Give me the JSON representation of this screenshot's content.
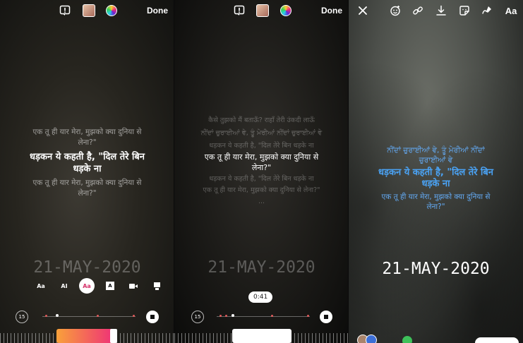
{
  "panel1": {
    "toolbar": {
      "done_label": "Done"
    },
    "lyrics": {
      "line_before": "एक तू ही यार मेरा, मुझको क्या दुनिया से लेना?\"",
      "current": "धड़कन ये कहती है, \"दिल तेरे बिन धड़के ना",
      "line_after": "एक तू ही यार मेरा, मुझको क्या दुनिया से लेना?\""
    },
    "date_sticker": "21-MAY-2020",
    "style_options": [
      "Aa",
      "AI",
      "Aa",
      "A",
      "video",
      "card"
    ],
    "skip_label": "15"
  },
  "panel2": {
    "toolbar": {
      "done_label": "Done"
    },
    "lyrics": {
      "l1": "कैसे तुझको मैं बताऊँ? राहाँ तेरी उंकदी लाऊँ",
      "l2": "ਨੀਂਦਾਂ ਚੁਰਾਈਆਂ ਵੇ, ਤੂੰ ਮੇਰੀਆਂ ਨੀਂਦਾਂ ਚੁਰਾਈਆਂ ਵੇ",
      "l3": "धड़कन ये कहती है, \"दिल तेरे बिन धड़के ना",
      "current": "एक तू ही यार मेरा, मुझको क्या दुनिया से लेना?\"",
      "l5": "धड़कन ये कहती है, \"दिल तेरे बिन धड़के ना",
      "l6": "एक तू ही यार मेरा, मुझको क्या दुनिया से लेना?\"",
      "ellipsis": "..."
    },
    "date_sticker": "21-MAY-2020",
    "time_bubble": "0:41",
    "skip_label": "15"
  },
  "panel3": {
    "toolbar": {
      "text_tool_label": "Aa"
    },
    "lyrics": {
      "before": "ਨੀਂਦਾਂ ਚੁਰਾਈਆਂ ਵੇ, ਤੂੰ ਮੇਰੀਆਂ ਨੀਂਦਾਂ ਚੁਰਾਈਆਂ ਵੇ",
      "current": "धड़कन ये कहती है, \"दिल तेरे बिन धड़के ना",
      "after": "एक तू ही यार मेरा, मुझको क्या दुनिया से लेना?\""
    },
    "date_sticker": "21-MAY-2020",
    "lyric_color": "#4aa3f5"
  },
  "colors": {
    "accent_pink": "#ee2a7b",
    "accent_orange": "#f9a13a",
    "done": "#ffffff"
  }
}
